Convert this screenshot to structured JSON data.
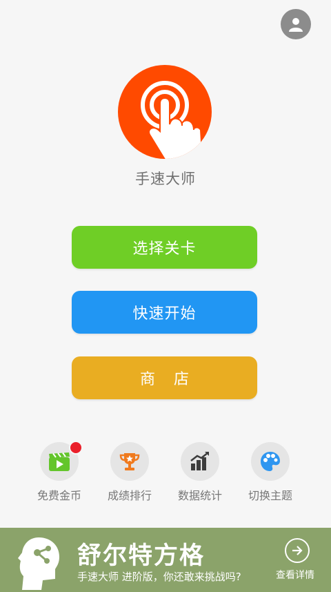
{
  "app": {
    "title": "手速大师"
  },
  "menu": {
    "select_level": "选择关卡",
    "quick_start": "快速开始",
    "shop": "商 店"
  },
  "features": [
    {
      "label": "免费金币",
      "icon": "video-clapper-icon"
    },
    {
      "label": "成绩排行",
      "icon": "trophy-icon"
    },
    {
      "label": "数据统计",
      "icon": "bar-chart-icon"
    },
    {
      "label": "切换主题",
      "icon": "palette-icon"
    }
  ],
  "banner": {
    "title": "舒尔特方格",
    "subtitle": "手速大师 进阶版，你还敢来挑战吗?",
    "more": "查看详情"
  },
  "colors": {
    "green": "#6fce26",
    "blue": "#2196f3",
    "orange": "#e9ad22",
    "logo": "#ff4a00",
    "banner": "#8ba36a",
    "badge": "#ea1f2a"
  }
}
